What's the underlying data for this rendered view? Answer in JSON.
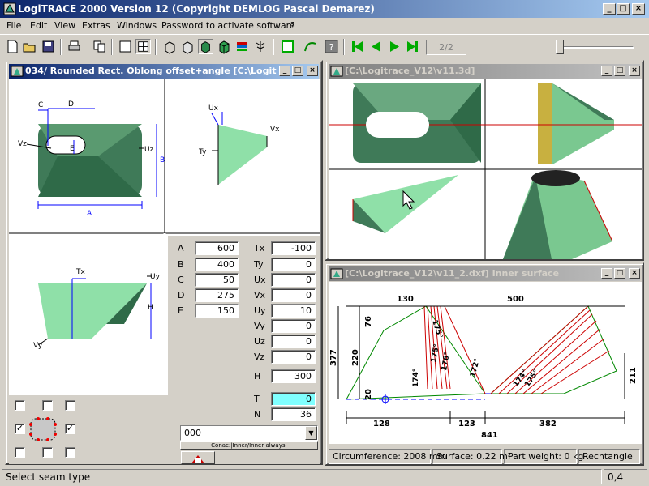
{
  "app": {
    "title": "LogiTRACE 2000  Version 12  (Copyright DEMLOG Pascal Demarez)",
    "title_buttons": [
      "_",
      "□",
      "×"
    ]
  },
  "menu": [
    "File",
    "Edit",
    "View",
    "Extras",
    "Windows",
    "Password to activate software",
    "?"
  ],
  "toolbar": {
    "page_indicator": "2/2"
  },
  "editor_window": {
    "title": "034/ Rounded Rect. Oblong offset+angle  [C:\\Logitrac...",
    "dims": {
      "A": "A",
      "B": "B",
      "C": "C",
      "D": "D",
      "E": "E",
      "Ux": "Ux",
      "Uy": "Uy",
      "Uz": "Uz",
      "Vx": "Vx",
      "Vz": "Vz",
      "Tx": "Tx",
      "Ty": "Ty",
      "H": "H",
      "Vy": "Vy"
    },
    "params_left": [
      {
        "label": "A",
        "value": "600"
      },
      {
        "label": "B",
        "value": "400"
      },
      {
        "label": "C",
        "value": "50"
      },
      {
        "label": "D",
        "value": "275"
      },
      {
        "label": "E",
        "value": "150"
      }
    ],
    "params_right": [
      {
        "label": "Tx",
        "value": "-100"
      },
      {
        "label": "Ty",
        "value": "0"
      },
      {
        "label": "Ux",
        "value": "0"
      },
      {
        "label": "Vx",
        "value": "0"
      },
      {
        "label": "Uy",
        "value": "10"
      },
      {
        "label": "Vy",
        "value": "0"
      },
      {
        "label": "Uz",
        "value": "0"
      },
      {
        "label": "Vz",
        "value": "0"
      },
      {
        "label": "H",
        "value": "300"
      },
      {
        "label": "T",
        "value": "0"
      },
      {
        "label": "N",
        "value": "36"
      }
    ],
    "seam_select": "000",
    "seam_button": "Conac:|Inner/Inner always|"
  },
  "view3d_window": {
    "title": "[C:\\Logitrace_V12\\v11.3d]"
  },
  "dxf_window": {
    "title": "[C:\\Logitrace_V12\\v11_2.dxf]  Inner surface",
    "dims": {
      "top_left": "130",
      "top_right": "500",
      "left_outer": "377",
      "left_mid": "220",
      "left_top": "76",
      "left_bottom": "20",
      "right": "211",
      "bottom_1": "128",
      "bottom_2": "123",
      "bottom_3": "382",
      "bottom_total": "841",
      "angle_a": "174°",
      "angle_b": "175°",
      "angle_c": "175°",
      "angle_d": "176°",
      "angle_e": "172°",
      "angle_f": "174°",
      "angle_g": "175°"
    },
    "info": {
      "circumference": "Circumference: 2008 mm",
      "surface": "Surface: 0.22 m²",
      "weight": "Part weight: 0 kg",
      "shape": "Rechtangle"
    }
  },
  "status": {
    "message": "Select seam type",
    "value": "0,4"
  },
  "colors": {
    "title_active": "#0a246a",
    "surface_green": "#8fe0a8",
    "dark_green": "#3f7a58",
    "seam_red": "#cc0000",
    "highlight_cyan": "#80ffff"
  }
}
